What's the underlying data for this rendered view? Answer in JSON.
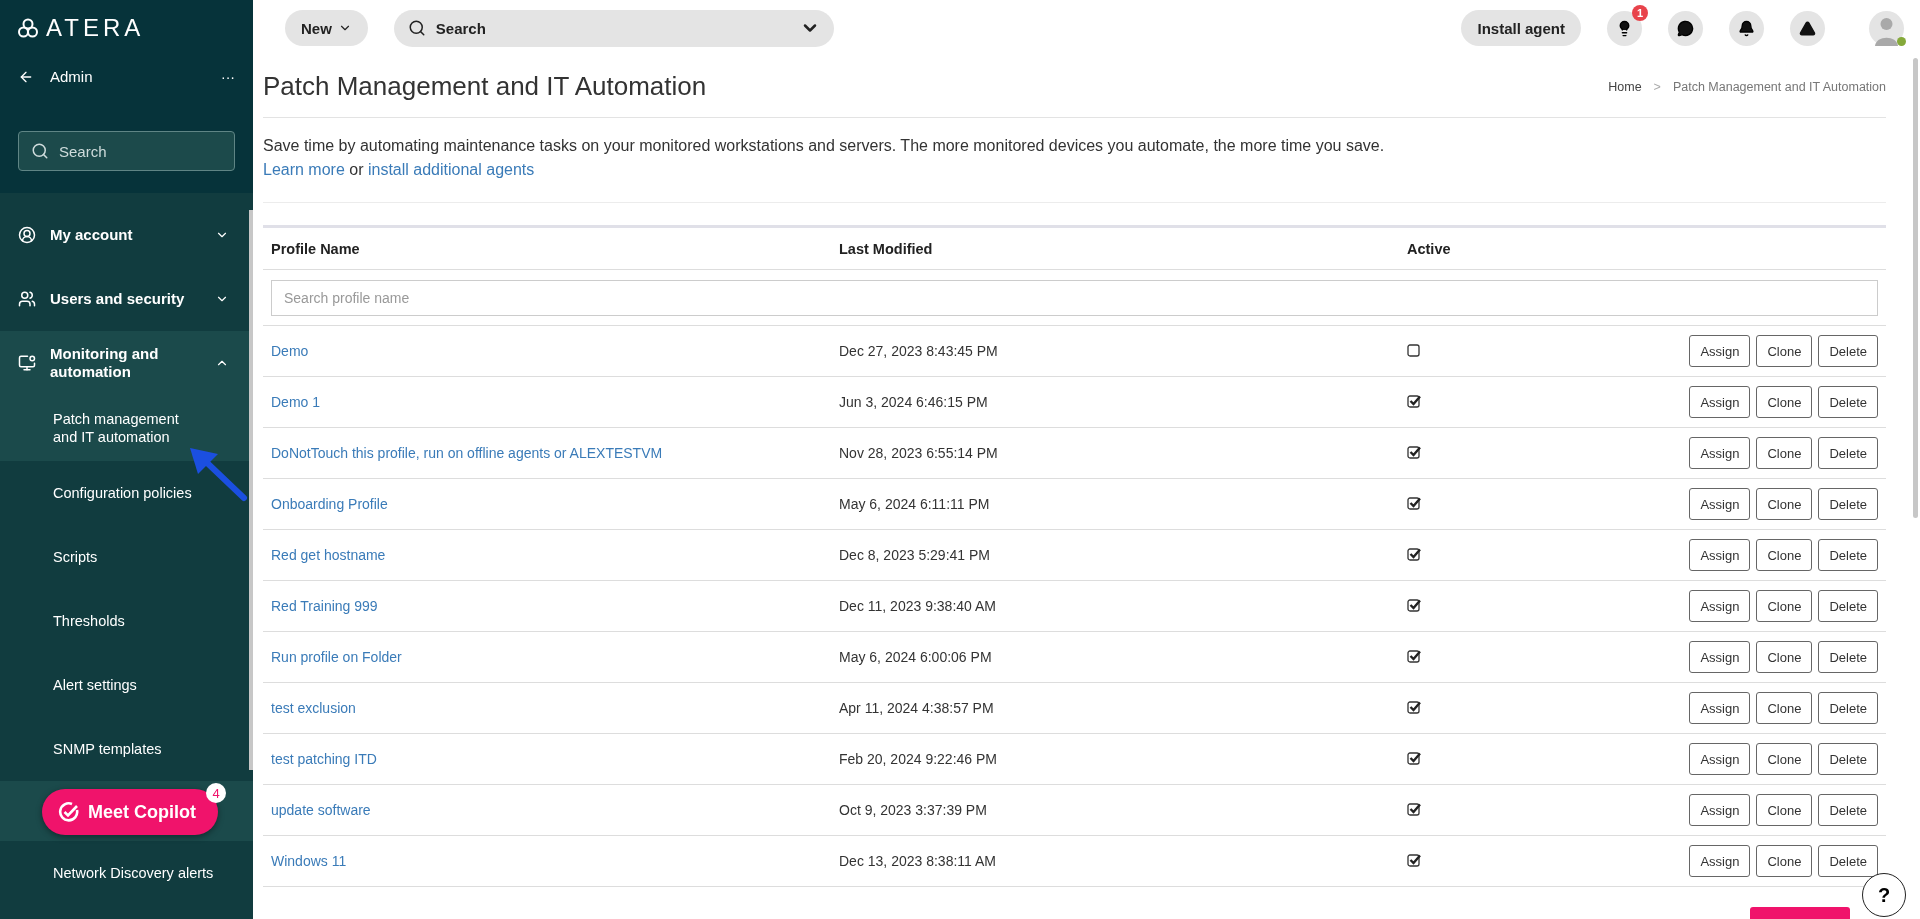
{
  "sidebar": {
    "logo": "ATERA",
    "back_label": "Admin",
    "more": "···",
    "search": {
      "placeholder": "Search"
    },
    "items": [
      {
        "label": "My account",
        "expanded": false
      },
      {
        "label": "Users and security",
        "expanded": false
      },
      {
        "label": "Monitoring and automation",
        "expanded": true,
        "children": [
          {
            "label": "Patch management and IT automation",
            "selected": true
          },
          {
            "label": "Configuration policies",
            "selected": false
          },
          {
            "label": "Scripts",
            "selected": false
          },
          {
            "label": "Thresholds",
            "selected": false
          },
          {
            "label": "Alert settings",
            "selected": false
          },
          {
            "label": "SNMP templates",
            "selected": false
          },
          {
            "label": "Network Discovery alerts",
            "selected": false
          }
        ]
      }
    ],
    "copilot": {
      "label": "Meet Copilot",
      "badge": "4"
    }
  },
  "topbar": {
    "new_label": "New",
    "search": {
      "placeholder": "Search"
    },
    "install_label": "Install agent",
    "tips_badge": "1",
    "avatar_online": true
  },
  "page": {
    "title": "Patch Management and IT Automation",
    "breadcrumb": [
      "Home",
      "Patch Management and IT Automation"
    ],
    "breadcrumb_separator": ">",
    "description": "Save time by automating maintenance tasks on your monitored workstations and servers. The more monitored devices you automate, the more time you save.",
    "learn_more": "Learn more",
    "or": "or",
    "install_link": "install additional agents"
  },
  "table": {
    "columns": [
      "Profile Name",
      "Last Modified",
      "Active"
    ],
    "search": {
      "placeholder": "Search profile name"
    },
    "rows": [
      {
        "name": "Demo",
        "modified": "Dec 27, 2023 8:43:45 PM",
        "active": false,
        "actions": [
          "Assign",
          "Clone",
          "Delete"
        ]
      },
      {
        "name": "Demo 1",
        "modified": "Jun 3, 2024 6:46:15 PM",
        "active": true,
        "actions": [
          "Assign",
          "Clone",
          "Delete"
        ]
      },
      {
        "name": "DoNotTouch this profile, run on offline agents or ALEXTESTVM",
        "modified": "Nov 28, 2023 6:55:14 PM",
        "active": true,
        "actions": [
          "Assign",
          "Clone",
          "Delete"
        ]
      },
      {
        "name": "Onboarding Profile",
        "modified": "May 6, 2024 6:11:11 PM",
        "active": true,
        "actions": [
          "Assign",
          "Clone",
          "Delete"
        ]
      },
      {
        "name": "Red get hostname",
        "modified": "Dec 8, 2023 5:29:41 PM",
        "active": true,
        "actions": [
          "Assign",
          "Clone",
          "Delete"
        ]
      },
      {
        "name": "Red Training 999",
        "modified": "Dec 11, 2023 9:38:40 AM",
        "active": true,
        "actions": [
          "Assign",
          "Clone",
          "Delete"
        ]
      },
      {
        "name": "Run profile on Folder",
        "modified": "May 6, 2024 6:00:06 PM",
        "active": true,
        "actions": [
          "Assign",
          "Clone",
          "Delete"
        ]
      },
      {
        "name": "test exclusion",
        "modified": "Apr 11, 2024 4:38:57 PM",
        "active": true,
        "actions": [
          "Assign",
          "Clone",
          "Delete"
        ]
      },
      {
        "name": "test patching ITD",
        "modified": "Feb 20, 2024 9:22:46 PM",
        "active": true,
        "actions": [
          "Assign",
          "Clone",
          "Delete"
        ]
      },
      {
        "name": "update software",
        "modified": "Oct 9, 2023 3:37:39 PM",
        "active": true,
        "actions": [
          "Assign",
          "Clone",
          "Delete"
        ]
      },
      {
        "name": "Windows 11",
        "modified": "Dec 13, 2023 8:38:11 AM",
        "active": true,
        "actions": [
          "Assign",
          "Clone",
          "Delete"
        ]
      }
    ]
  },
  "help": {
    "label": "?"
  }
}
